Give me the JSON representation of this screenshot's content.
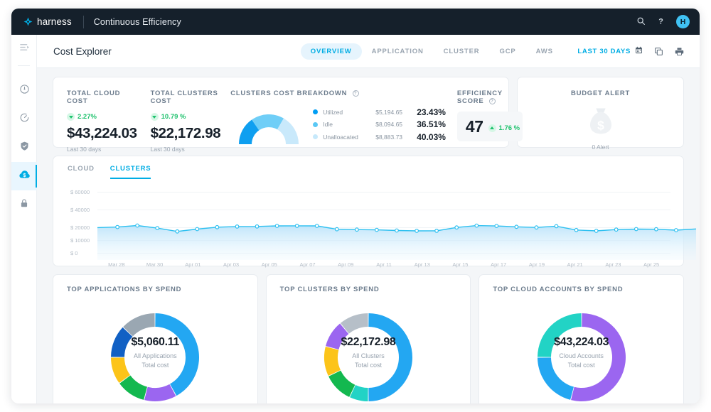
{
  "topbar": {
    "brand": "harness",
    "module": "Continuous Efficiency",
    "search_icon": "search-icon",
    "help_icon": "help-icon",
    "avatar_initial": "H"
  },
  "rail": {
    "items": [
      {
        "name": "menu-collapse-icon",
        "label": "Menu"
      },
      {
        "name": "dashboard-icon",
        "label": "Dashboard"
      },
      {
        "name": "deployments-icon",
        "label": "Deployments"
      },
      {
        "name": "security-icon",
        "label": "Security"
      },
      {
        "name": "cloud-cost-icon",
        "label": "Cloud Cost",
        "active": true
      },
      {
        "name": "lock-icon",
        "label": "Access Control"
      }
    ]
  },
  "subheader": {
    "page_title": "Cost Explorer",
    "tabs": [
      {
        "label": "OVERVIEW",
        "active": true
      },
      {
        "label": "APPLICATION",
        "active": false
      },
      {
        "label": "CLUSTER",
        "active": false
      },
      {
        "label": "GCP",
        "active": false
      },
      {
        "label": "AWS",
        "active": false
      }
    ],
    "date_range": "LAST 30 DAYS",
    "calendar_icon": "calendar-icon",
    "copy_icon": "copy-icon",
    "print_icon": "print-icon"
  },
  "kpi": {
    "total_cloud_cost": {
      "label": "TOTAL CLOUD COST",
      "change": "2.27%",
      "change_direction": "down",
      "value": "$43,224.03",
      "sub": "Last 30 days"
    },
    "total_clusters_cost": {
      "label": "TOTAL CLUSTERS COST",
      "change": "10.79 %",
      "change_direction": "down",
      "value": "$22,172.98",
      "sub": "Last 30 days"
    },
    "clusters_breakdown": {
      "label": "CLUSTERS COST BREAKDOWN",
      "info_icon": "info-icon",
      "rows": [
        {
          "name": "Utilized",
          "amount": "$5,194.65",
          "percent": "23.43%",
          "color": "#009ef4"
        },
        {
          "name": "Idle",
          "amount": "$8,094.65",
          "percent": "36.51%",
          "color": "#5ac8f5"
        },
        {
          "name": "Unalloacated",
          "amount": "$8,883.73",
          "percent": "40.03%",
          "color": "#c7e9fb"
        }
      ]
    },
    "efficiency_score": {
      "label": "EFFICIENCY SCORE",
      "info_icon": "info-icon",
      "score": "47",
      "change": "1.76 %",
      "change_direction": "up"
    },
    "budget_alert": {
      "label": "BUDGET ALERT",
      "icon": "money-bag-icon",
      "sub": "0 Alert"
    }
  },
  "trend": {
    "tabs": [
      {
        "label": "CLOUD",
        "active": false
      },
      {
        "label": "CLUSTERS",
        "active": true
      }
    ]
  },
  "chart_data": {
    "type": "area",
    "title": "",
    "xlabel": "",
    "ylabel": "",
    "ylim": [
      0,
      60000
    ],
    "ytick_labels": [
      "$ 60000",
      "$ 40000",
      "$ 20000",
      "$ 10000",
      "$ 0"
    ],
    "ytick_values": [
      60000,
      40000,
      20000,
      10000,
      0
    ],
    "grid": true,
    "legend": "none",
    "line_color": "#2ec0f0",
    "fill_color": "#d6eefb",
    "x": [
      "Mar 27",
      "Mar 28",
      "Mar 29",
      "Mar 30",
      "Mar 31",
      "Apr 01",
      "Apr 02",
      "Apr 03",
      "Apr 04",
      "Apr 05",
      "Apr 06",
      "Apr 07",
      "Apr 08",
      "Apr 09",
      "Apr 10",
      "Apr 11",
      "Apr 12",
      "Apr 13",
      "Apr 14",
      "Apr 15",
      "Apr 16",
      "Apr 17",
      "Apr 18",
      "Apr 19",
      "Apr 20",
      "Apr 21",
      "Apr 22",
      "Apr 23",
      "Apr 24",
      "Apr 25",
      "Apr 26"
    ],
    "xtick_labels": [
      "Mar 28",
      "Mar 30",
      "Apr 01",
      "Apr 03",
      "Apr 05",
      "Apr 07",
      "Apr 09",
      "Apr 11",
      "Apr 13",
      "Apr 15",
      "Apr 17",
      "Apr 19",
      "Apr 21",
      "Apr 23",
      "Apr 25"
    ],
    "series": [
      {
        "name": "Clusters cost",
        "values": [
          19800,
          20300,
          22000,
          19400,
          16800,
          18600,
          20200,
          20900,
          21000,
          21600,
          21700,
          21600,
          18500,
          18200,
          18000,
          17500,
          17200,
          17300,
          19900,
          21900,
          21500,
          20600,
          19900,
          21300,
          17900,
          17200,
          18200,
          18600,
          18500,
          17800,
          18700
        ]
      }
    ]
  },
  "donuts": [
    {
      "title": "TOP APPLICATIONS BY SPEND",
      "amount": "$5,060.11",
      "caption_1": "All Applications",
      "caption_2": "Total cost",
      "slices": [
        {
          "value": 42,
          "color": "#23a7f2"
        },
        {
          "value": 12,
          "color": "#9b66f0"
        },
        {
          "value": 11,
          "color": "#13b84f"
        },
        {
          "value": 10,
          "color": "#fcc419"
        },
        {
          "value": 12,
          "color": "#1160c4"
        },
        {
          "value": 13,
          "color": "#9aa7b2"
        }
      ]
    },
    {
      "title": "TOP CLUSTERS BY SPEND",
      "amount": "$22,172.98",
      "caption_1": "All Clusters",
      "caption_2": "Total cost",
      "slices": [
        {
          "value": 50,
          "color": "#23a7f2"
        },
        {
          "value": 7,
          "color": "#22d3c5"
        },
        {
          "value": 11,
          "color": "#13b84f"
        },
        {
          "value": 11,
          "color": "#fcc419"
        },
        {
          "value": 10,
          "color": "#9b66f0"
        },
        {
          "value": 11,
          "color": "#b6bfc8"
        }
      ]
    },
    {
      "title": "TOP CLOUD ACCOUNTS BY SPEND",
      "amount": "$43,224.03",
      "caption_1": "Cloud Accounts",
      "caption_2": "Total cost",
      "slices": [
        {
          "value": 54,
          "color": "#9b66f0"
        },
        {
          "value": 21,
          "color": "#23a7f2"
        },
        {
          "value": 25,
          "color": "#22d3c5"
        }
      ]
    }
  ]
}
